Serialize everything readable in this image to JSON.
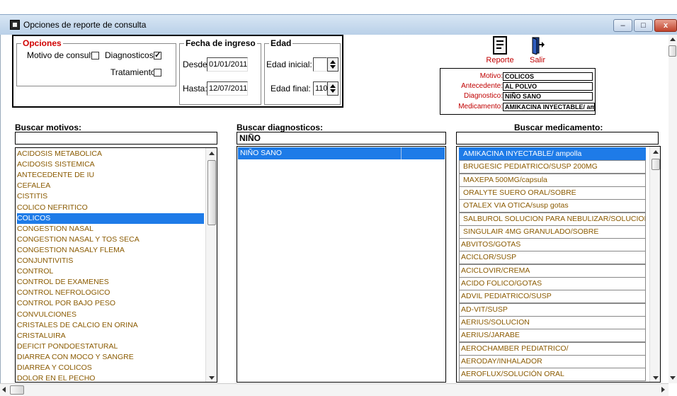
{
  "window": {
    "title": "Opciones de reporte de consulta",
    "buttons": {
      "minimize": "–",
      "maximize": "□",
      "close": "x"
    }
  },
  "opciones": {
    "title": "Opciones",
    "motivo": {
      "label": "Motivo de consulta",
      "checked": false
    },
    "diagnosticos": {
      "label": "Diagnosticos",
      "checked": true
    },
    "tratamiento": {
      "label": "Tratamiento",
      "checked": false
    }
  },
  "fecha": {
    "title": "Fecha de ingreso",
    "desde_label": "Desde:",
    "desde_value": "01/01/2011",
    "hasta_label": "Hasta:",
    "hasta_value": "12/07/2011"
  },
  "edad": {
    "title": "Edad",
    "inicial_label": "Edad inicial:",
    "inicial_value": "",
    "final_label": "Edad final:",
    "final_value": "110"
  },
  "toolbar": {
    "reporte": "Reporte",
    "salir": "Salir"
  },
  "summary": {
    "motivo_label": "Motivo:",
    "motivo_value": "COLICOS",
    "antecedente_label": "Antecedente:",
    "antecedente_value": "AL POLVO",
    "diagnostico_label": "Diagnostico:",
    "diagnostico_value": "NIÑO SANO",
    "medicamento_label": "Medicamento:",
    "medicamento_value": "AMIKACINA INYECTABLE/ ampolla"
  },
  "motivos": {
    "header": "Buscar motivos:",
    "search_value": "",
    "items": [
      "ACIDOSIS METABOLICA",
      "ACIDOSIS SISTEMICA",
      "ANTECEDENTE DE IU",
      "CEFALEA",
      "CISTITIS",
      "COLICO NEFRITICO",
      "COLICOS",
      "CONGESTION NASAL",
      "CONGESTION NASAL Y TOS SECA",
      "CONGESTION NASALY FLEMA",
      "CONJUNTIVITIS",
      "CONTROL",
      "CONTROL DE EXAMENES",
      "CONTROL NEFROLOGICO",
      "CONTROL POR BAJO PESO",
      "CONVULCIONES",
      "CRISTALES DE CALCIO EN ORINA",
      "CRISTALUIRA",
      "DEFICIT PONDOESTATURAL",
      "DIARREA CON MOCO Y SANGRE",
      "DIARREA Y COLICOS",
      "DOLOR EN EL PECHO"
    ],
    "selected": 6
  },
  "diagnosticos": {
    "header": "Buscar diagnosticos:",
    "search_value": "NIÑO",
    "items": [
      "NIÑO SANO"
    ]
  },
  "medicamentos": {
    "header": "Buscar medicamento:",
    "search_value": "",
    "items": [
      "AMIKACINA INYECTABLE/ ampolla",
      "BRUGESIC  PEDIATRICO/SUSP 200MG",
      "MAXEPA 500MG/capsula",
      "ORALYTE SUERO ORAL/SOBRE",
      "OTALEX VIA OTICA/susp gotas",
      "SALBUROL SOLUCION PARA NEBULIZAR/SOLUCION",
      "SINGULAIR  4MG GRANULADO/SOBRE",
      "ABVITOS/GOTAS",
      "ACICLOR/SUSP",
      "ACICLOVIR/CREMA",
      "ACIDO FOLICO/GOTAS",
      "ADVIL PEDIATRICO/SUSP",
      "AD-VIT/SUSP",
      "AERIUS/solucion",
      "AERIUS/JARABE",
      "AEROCHAMBER PEDIATRICO/",
      "AERODAY/INHALADOR",
      "AEROFLUX/SOLUCIÓN ORAL"
    ],
    "selected": 0
  }
}
